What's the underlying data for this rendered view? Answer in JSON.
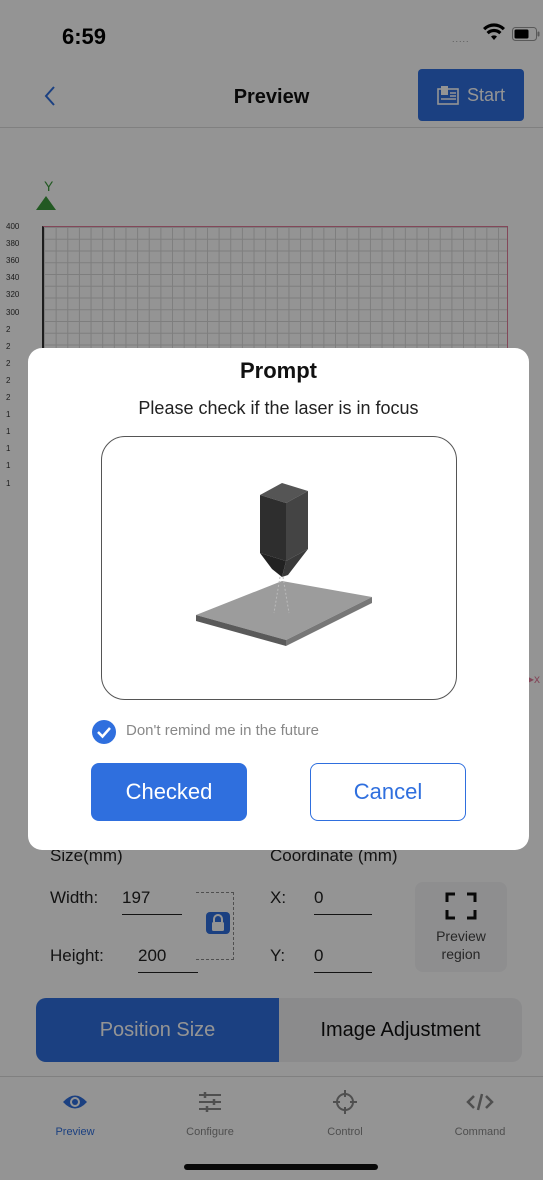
{
  "status": {
    "time": "6:59",
    "signal": "....."
  },
  "nav": {
    "title": "Preview",
    "start_label": "Start"
  },
  "canvas": {
    "y_axis_label": "Y",
    "y_ticks": [
      "400",
      "380",
      "360",
      "340",
      "320",
      "300",
      "2",
      "2",
      "2",
      "2",
      "2",
      "1",
      "1",
      "1",
      "1",
      "1"
    ],
    "x_arrow": "▸x"
  },
  "settings": {
    "size_label": "Size(mm)",
    "coord_label": "Coordinate (mm)",
    "width_label": "Width:",
    "width_value": "197",
    "height_label": "Height:",
    "height_value": "200",
    "x_label": "X:",
    "x_value": "0",
    "y_label": "Y:",
    "y_value": "0",
    "preview_region_line1": "Preview",
    "preview_region_line2": "region"
  },
  "segment": {
    "items": [
      "Position Size",
      "Image Adjustment"
    ],
    "active_index": 0
  },
  "tabs": [
    {
      "label": "Preview",
      "icon": "eye-icon",
      "active": true
    },
    {
      "label": "Configure",
      "icon": "sliders-icon",
      "active": false
    },
    {
      "label": "Control",
      "icon": "crosshair-icon",
      "active": false
    },
    {
      "label": "Command",
      "icon": "code-icon",
      "active": false
    }
  ],
  "dialog": {
    "title": "Prompt",
    "message": "Please check if the laser is in focus",
    "checkbox_label": "Don't remind me in the future",
    "checkbox_checked": true,
    "confirm_label": "Checked",
    "cancel_label": "Cancel"
  },
  "colors": {
    "accent": "#2f6fde",
    "axis_green": "#3c9a3c",
    "grid_pink": "#e27b9a"
  }
}
